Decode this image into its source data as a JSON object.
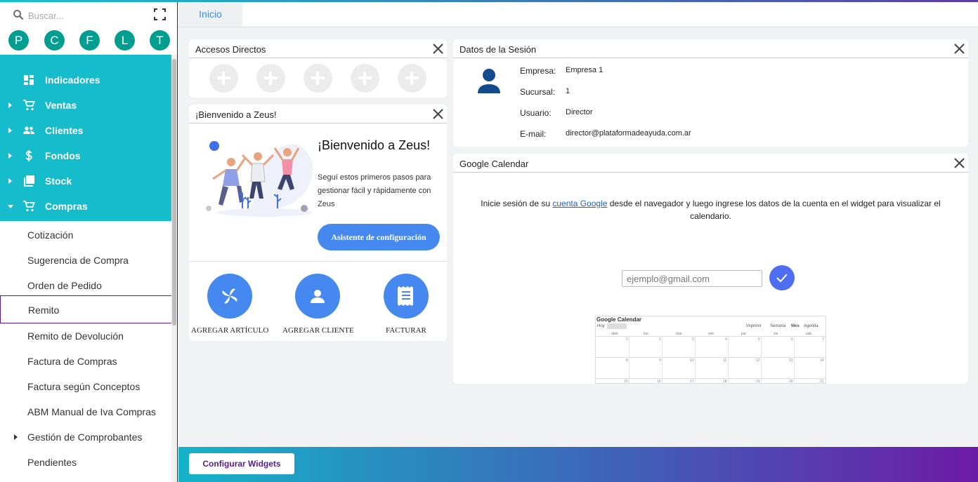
{
  "sidebar": {
    "search_placeholder": "Buscar...",
    "avatars": [
      "P",
      "C",
      "F",
      "L",
      "T"
    ],
    "menu": [
      {
        "label": "Indicadores",
        "icon": "dashboard-icon"
      },
      {
        "label": "Ventas",
        "icon": "cart-icon"
      },
      {
        "label": "Clientes",
        "icon": "people-icon"
      },
      {
        "label": "Fondos",
        "icon": "dollar-icon"
      },
      {
        "label": "Stock",
        "icon": "stock-icon"
      },
      {
        "label": "Compras",
        "icon": "cart-plus-icon"
      }
    ],
    "submenu": [
      {
        "label": "Cotización"
      },
      {
        "label": "Sugerencia de Compra"
      },
      {
        "label": "Orden de Pedido"
      },
      {
        "label": "Remito"
      },
      {
        "label": "Remito de Devolución"
      },
      {
        "label": "Factura de Compras"
      },
      {
        "label": "Factura según Conceptos"
      },
      {
        "label": "ABM Manual de Iva Compras"
      },
      {
        "label": "Gestión de Comprobantes"
      },
      {
        "label": "Pendientes"
      }
    ]
  },
  "tabs": [
    "Inicio"
  ],
  "accesos": {
    "title": "Accesos Directos"
  },
  "welcome": {
    "title": "¡Bienvenido a Zeus!",
    "heading": "¡Bienvenido a Zeus!",
    "text": "Seguí estos primeros pasos para gestionar fácil y rápidamente con Zeus",
    "wizard": "Asistente de configuración",
    "actions": [
      "AGREGAR ARTÍCULO",
      "AGREGAR CLIENTE",
      "FACTURAR"
    ]
  },
  "session": {
    "title": "Datos de la Sesión",
    "fields": [
      {
        "label": "Empresa:",
        "value": "Empresa 1"
      },
      {
        "label": "Sucursal:",
        "value": "1"
      },
      {
        "label": "Usuario:",
        "value": "Director"
      },
      {
        "label": "E-mail:",
        "value": "director@plataformadeayuda.com.ar"
      }
    ]
  },
  "gcal": {
    "title": "Google Calendar",
    "msg_before": "Inicie sesión de su ",
    "msg_link": "cuenta Google",
    "msg_after": " desde el navegador y luego ingrese los datos de la cuenta en el widget para visualizar el calendario.",
    "email_placeholder": "ejemplo@gmail.com",
    "preview": {
      "title": "Google Calendar",
      "today": "Hoy",
      "print": "Imprimir",
      "views": [
        "Semana",
        "Mes",
        "Agenda"
      ],
      "days": [
        "dom",
        "lun",
        "mar",
        "mié",
        "jue",
        "vie",
        "sáb"
      ],
      "weeks": [
        [
          "1",
          "2",
          "3",
          "4",
          "5",
          "6",
          "7"
        ],
        [
          "8",
          "9",
          "10",
          "11",
          "12",
          "13",
          "14"
        ],
        [
          "15",
          "16",
          "17",
          "18",
          "19",
          "20",
          "21"
        ]
      ]
    }
  },
  "footer": {
    "configure": "Configurar Widgets"
  },
  "colors": {
    "teal": "#15bccb",
    "avatar": "#009e90",
    "blue": "#4589f0",
    "purple": "#5b1a8a"
  }
}
